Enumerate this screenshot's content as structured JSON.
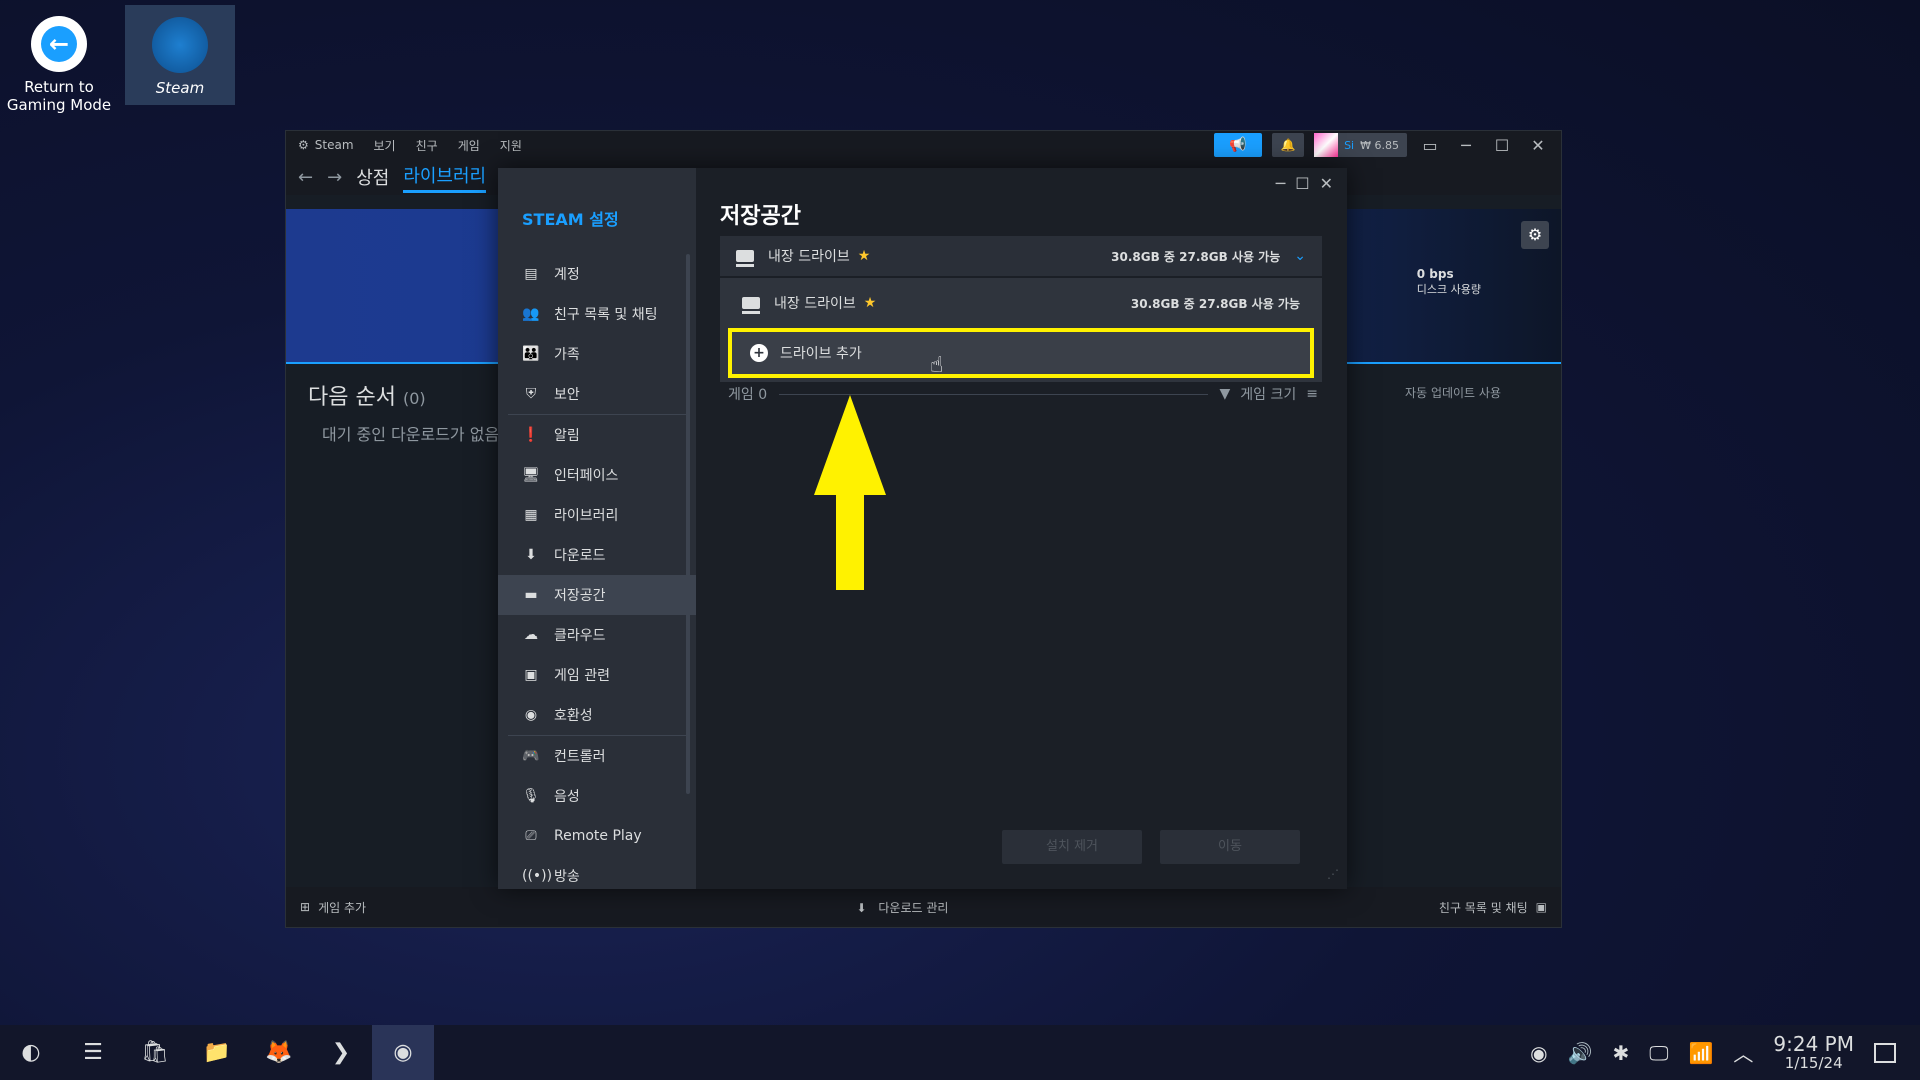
{
  "desktop": {
    "icons": [
      {
        "label": "Return to Gaming Mode"
      },
      {
        "label": "Steam"
      }
    ]
  },
  "steam": {
    "title": "Steam",
    "menu": [
      "보기",
      "친구",
      "게임",
      "지원"
    ],
    "user": {
      "name": "Si",
      "balance": "₩ 6.85"
    },
    "nav": {
      "store": "상점",
      "library": "라이브러리"
    },
    "downloads": {
      "rate": "0 bps",
      "rate_label": "디스크 사용량",
      "queue_title": "다음 순서",
      "queue_count": "(0)",
      "queue_empty": "대기 중인 다운로드가 없음",
      "auto_update": "자동 업데이트 사용"
    },
    "bottombar": {
      "add_game": "게임 추가",
      "manage_downloads": "다운로드 관리",
      "friends_chat": "친구 목록 및 채팅"
    }
  },
  "settings": {
    "heading": "STEAM 설정",
    "items": [
      {
        "label": "계정",
        "icon": "account-icon"
      },
      {
        "label": "친구 목록 및 채팅",
        "icon": "friends-icon"
      },
      {
        "label": "가족",
        "icon": "family-icon"
      },
      {
        "label": "보안",
        "icon": "shield-icon"
      },
      {
        "label": "알림",
        "icon": "alert-icon"
      },
      {
        "label": "인터페이스",
        "icon": "monitor-icon"
      },
      {
        "label": "라이브러리",
        "icon": "grid-icon"
      },
      {
        "label": "다운로드",
        "icon": "download-icon"
      },
      {
        "label": "저장공간",
        "icon": "drive-icon",
        "active": true
      },
      {
        "label": "클라우드",
        "icon": "cloud-icon"
      },
      {
        "label": "게임 관련",
        "icon": "game-window-icon"
      },
      {
        "label": "호환성",
        "icon": "steam-icon"
      },
      {
        "label": "컨트롤러",
        "icon": "gamepad-icon"
      },
      {
        "label": "음성",
        "icon": "mic-icon"
      },
      {
        "label": "Remote Play",
        "icon": "cast-icon"
      },
      {
        "label": "방송",
        "icon": "broadcast-icon"
      }
    ],
    "storage": {
      "title": "저장공간",
      "selected_drive": {
        "name": "내장 드라이브",
        "space": "30.8GB 중 27.8GB 사용 가능"
      },
      "dropdown": [
        {
          "name": "내장 드라이브",
          "space": "30.8GB 중 27.8GB 사용 가능"
        }
      ],
      "add_drive": "드라이브 추가",
      "games_label": "게임 0",
      "sort_label": "게임 크기",
      "uninstall": "설치 제거",
      "move": "이동"
    }
  },
  "taskbar": {
    "time": "9:24 PM",
    "date": "1/15/24"
  },
  "colors": {
    "accent": "#1a9fff",
    "highlight": "#fff200",
    "star": "#ffc82c"
  }
}
